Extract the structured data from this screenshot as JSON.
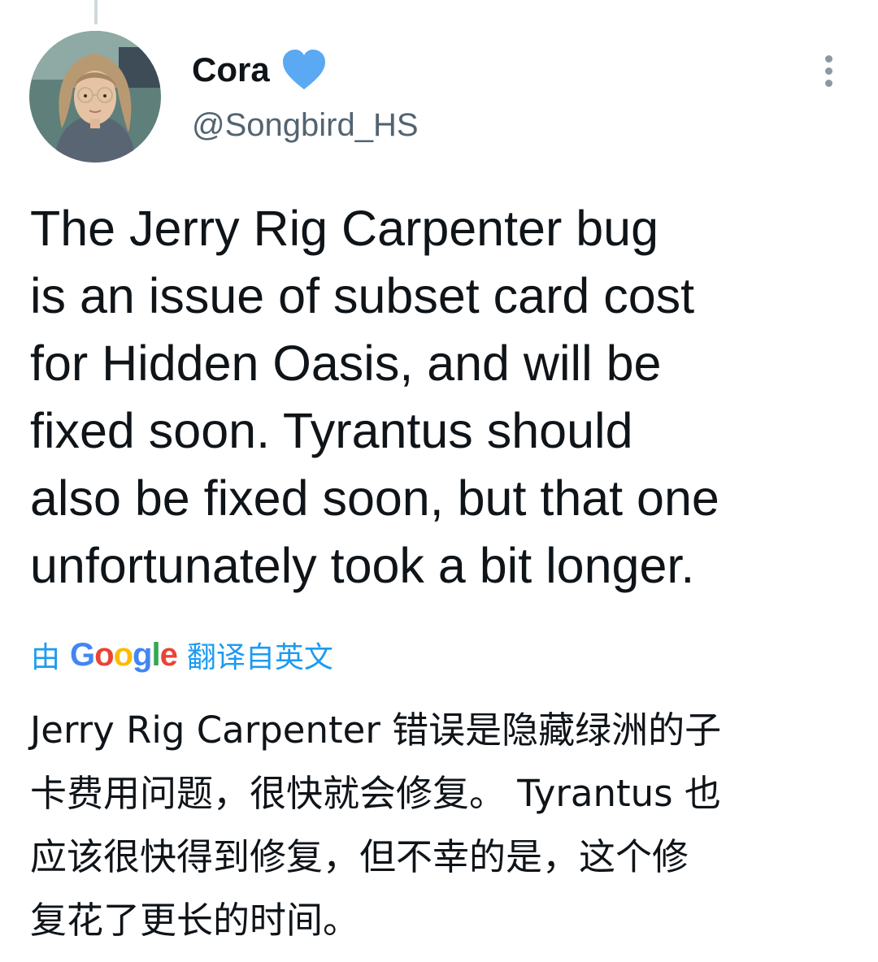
{
  "user": {
    "display_name": "Cora",
    "handle": "@Songbird_HS",
    "verified": true
  },
  "tweet": {
    "text": "The Jerry Rig Carpenter bug\nis an issue of subset card cost\nfor Hidden Oasis, and will be\nfixed soon. Tyrantus should\nalso be fixed soon, but that one\nunfortunately took a bit longer."
  },
  "translation": {
    "prefix": "由",
    "provider": "Google",
    "suffix": "翻译自英文",
    "text": "Jerry Rig Carpenter 错误是隐藏绿洲的子\n卡费用问题，很快就会修复。 Tyrantus 也\n应该很快得到修复，但不幸的是，这个修\n复花了更长的时间。"
  },
  "colors": {
    "accent": "#1d9bf0",
    "verified_badge": "#1d9bf0",
    "secondary_text": "#536471"
  },
  "icons": {
    "verified": "verified-heart-icon",
    "more": "more-vertical-icon"
  }
}
